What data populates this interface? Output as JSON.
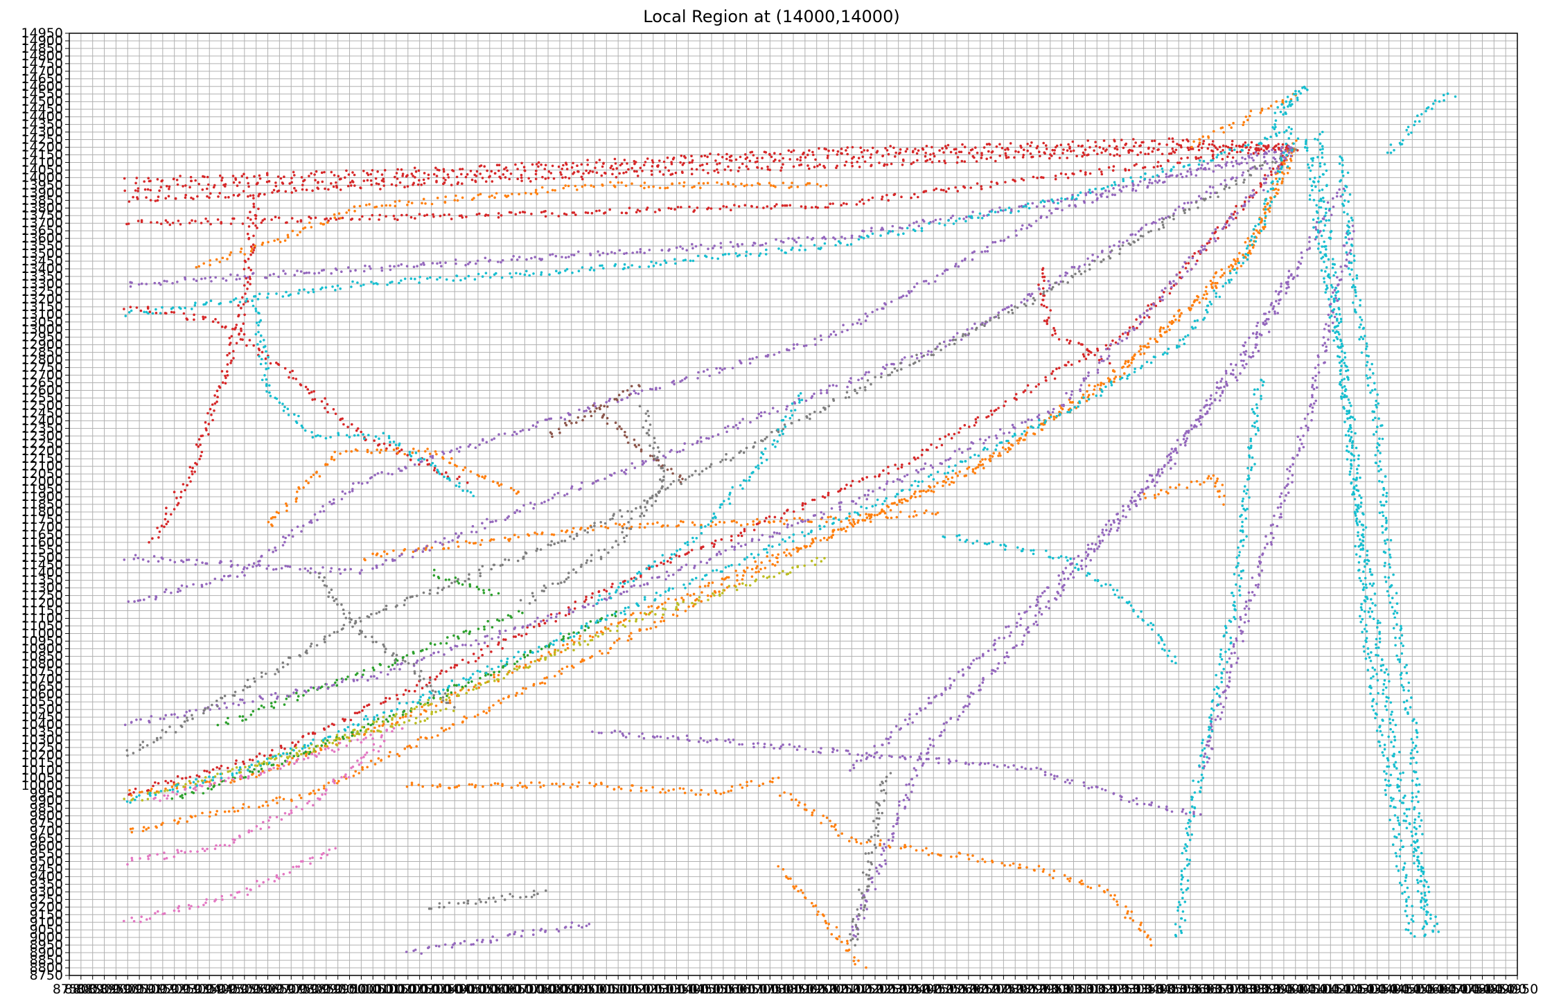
{
  "chart_data": {
    "type": "scatter",
    "title": "Local Region at (14000,14000)",
    "xlabel": "",
    "ylabel": "",
    "xlim": [
      8750,
      14950
    ],
    "ylim": [
      8750,
      14950
    ],
    "x_tick_step": 50,
    "y_tick_step": 50,
    "grid": true,
    "legend": "none",
    "marker": "point",
    "palette": [
      "#1f77b4",
      "#ff7f0e",
      "#2ca02c",
      "#d62728",
      "#9467bd",
      "#8c564b",
      "#e377c2",
      "#7f7f7f",
      "#bcbd22",
      "#17becf"
    ],
    "series": [
      {
        "color": "#d62728",
        "paths": [
          [
            [
              9000,
              13850
            ],
            [
              10500,
              13980
            ],
            [
              12000,
              14080
            ],
            [
              13500,
              14180
            ],
            [
              14000,
              14200
            ]
          ],
          [
            [
              9000,
              13920
            ],
            [
              10500,
              14020
            ],
            [
              12000,
              14140
            ],
            [
              13500,
              14200
            ],
            [
              14000,
              14200
            ]
          ],
          [
            [
              9000,
              13980
            ],
            [
              10500,
              14060
            ],
            [
              12000,
              14180
            ],
            [
              13500,
              14240
            ],
            [
              14000,
              14200
            ]
          ],
          [
            [
              9000,
              13700
            ],
            [
              10500,
              13750
            ],
            [
              12000,
              13820
            ],
            [
              14000,
              14200
            ]
          ],
          [
            [
              9550,
              13900
            ],
            [
              9500,
              13200
            ],
            [
              9400,
              12600
            ],
            [
              9250,
              12000
            ],
            [
              9100,
              11600
            ]
          ],
          [
            [
              9000,
              9950
            ],
            [
              9600,
              10200
            ],
            [
              10300,
              10700
            ],
            [
              11200,
              11400
            ],
            [
              12300,
              12100
            ],
            [
              13300,
              13000
            ],
            [
              14000,
              14200
            ]
          ],
          [
            [
              9000,
              13150
            ],
            [
              9400,
              13050
            ],
            [
              9700,
              12700
            ],
            [
              10000,
              12300
            ],
            [
              10450,
              12000
            ]
          ],
          [
            [
              12900,
              13400
            ],
            [
              12950,
              13000
            ],
            [
              13200,
              12780
            ]
          ]
        ]
      },
      {
        "color": "#ff7f0e",
        "paths": [
          [
            [
              9000,
              9950
            ],
            [
              9500,
              10050
            ],
            [
              10200,
              10450
            ],
            [
              11000,
              11000
            ],
            [
              12000,
              11650
            ],
            [
              12700,
              12150
            ],
            [
              13300,
              12800
            ],
            [
              13800,
              13550
            ],
            [
              14000,
              14200
            ]
          ],
          [
            [
              9000,
              9700
            ],
            [
              9800,
              9950
            ],
            [
              10800,
              10700
            ],
            [
              11800,
              11500
            ],
            [
              12600,
              12050
            ],
            [
              13200,
              12650
            ],
            [
              13800,
              13500
            ],
            [
              14000,
              14250
            ]
          ],
          [
            [
              10200,
              10000
            ],
            [
              11000,
              10000
            ],
            [
              11500,
              9950
            ],
            [
              11800,
              10050
            ]
          ],
          [
            [
              11800,
              9950
            ],
            [
              12100,
              9650
            ],
            [
              12900,
              9450
            ],
            [
              13200,
              9300
            ],
            [
              13400,
              8950
            ]
          ],
          [
            [
              11800,
              9450
            ],
            [
              12000,
              9100
            ],
            [
              12150,
              8800
            ]
          ],
          [
            [
              9600,
              11700
            ],
            [
              9900,
              12200
            ],
            [
              10300,
              12200
            ],
            [
              10700,
              11900
            ]
          ],
          [
            [
              10000,
              11500
            ],
            [
              11000,
              11700
            ],
            [
              12000,
              11750
            ],
            [
              12500,
              11800
            ]
          ],
          [
            [
              13350,
              11900
            ],
            [
              13500,
              11950
            ],
            [
              13650,
              12050
            ],
            [
              13700,
              11850
            ]
          ],
          [
            [
              14000,
              14550
            ],
            [
              13800,
              14400
            ],
            [
              13550,
              14200
            ]
          ],
          [
            [
              9300,
              13400
            ],
            [
              10000,
              13800
            ],
            [
              11000,
              13950
            ],
            [
              12000,
              13950
            ]
          ]
        ]
      },
      {
        "color": "#2ca02c",
        "paths": [
          [
            [
              9200,
              9900
            ],
            [
              9900,
              10300
            ],
            [
              10500,
              10700
            ],
            [
              11100,
              11150
            ]
          ],
          [
            [
              9400,
              10400
            ],
            [
              10100,
              10800
            ],
            [
              10700,
              11150
            ]
          ],
          [
            [
              10300,
              11400
            ],
            [
              10600,
              11250
            ]
          ]
        ]
      },
      {
        "color": "#9467bd",
        "paths": [
          [
            [
              9000,
              13300
            ],
            [
              10000,
              13400
            ],
            [
              11000,
              13500
            ],
            [
              12000,
              13600
            ],
            [
              13000,
              13850
            ],
            [
              14000,
              14200
            ]
          ],
          [
            [
              9000,
              11200
            ],
            [
              9500,
              11400
            ],
            [
              10000,
              12000
            ],
            [
              11000,
              12500
            ],
            [
              12000,
              12950
            ],
            [
              13000,
              13800
            ],
            [
              14000,
              14200
            ]
          ],
          [
            [
              9000,
              11500
            ],
            [
              10000,
              11400
            ],
            [
              11500,
              12300
            ],
            [
              12500,
              12900
            ],
            [
              13500,
              13800
            ],
            [
              14000,
              14200
            ]
          ],
          [
            [
              9000,
              10400
            ],
            [
              10000,
              10700
            ],
            [
              11000,
              11200
            ],
            [
              12000,
              11800
            ],
            [
              13000,
              12500
            ],
            [
              14000,
              14200
            ]
          ],
          [
            [
              11000,
              10350
            ],
            [
              11500,
              10300
            ],
            [
              12200,
              10200
            ],
            [
              12900,
              10100
            ],
            [
              13300,
              9900
            ],
            [
              13600,
              9800
            ]
          ],
          [
            [
              12100,
              10100
            ],
            [
              12700,
              10900
            ],
            [
              13200,
              11700
            ],
            [
              13800,
              12800
            ],
            [
              14200,
              13950
            ]
          ],
          [
            [
              12100,
              9000
            ],
            [
              12400,
              10200
            ],
            [
              12900,
              11100
            ],
            [
              13500,
              12200
            ],
            [
              14000,
              13400
            ]
          ],
          [
            [
              13600,
              10100
            ],
            [
              13800,
              11200
            ],
            [
              14050,
              12400
            ],
            [
              14250,
              13700
            ]
          ],
          [
            [
              10200,
              8900
            ],
            [
              10600,
              9000
            ],
            [
              11000,
              9100
            ]
          ]
        ]
      },
      {
        "color": "#8c564b",
        "paths": [
          [
            [
              10800,
              12300
            ],
            [
              11050,
              12500
            ],
            [
              11200,
              12650
            ]
          ],
          [
            [
              11000,
              12500
            ],
            [
              11200,
              12200
            ],
            [
              11400,
              12000
            ]
          ]
        ]
      },
      {
        "color": "#e377c2",
        "paths": [
          [
            [
              9000,
              9500
            ],
            [
              9400,
              9600
            ],
            [
              9800,
              9900
            ],
            [
              10100,
              10300
            ]
          ],
          [
            [
              9000,
              9100
            ],
            [
              9500,
              9300
            ],
            [
              9900,
              9600
            ]
          ],
          [
            [
              9100,
              9900
            ],
            [
              9600,
              10100
            ],
            [
              10200,
              10400
            ]
          ]
        ]
      },
      {
        "color": "#7f7f7f",
        "paths": [
          [
            [
              9000,
              10200
            ],
            [
              10000,
              11100
            ],
            [
              11000,
              11700
            ],
            [
              12000,
              12500
            ],
            [
              13000,
              13300
            ],
            [
              14000,
              14200
            ]
          ],
          [
            [
              12100,
              8950
            ],
            [
              12150,
              9300
            ],
            [
              12200,
              9700
            ],
            [
              12250,
              10100
            ]
          ],
          [
            [
              9800,
              11400
            ],
            [
              10000,
              11000
            ],
            [
              10200,
              10800
            ],
            [
              10400,
              10500
            ]
          ],
          [
            [
              10300,
              9200
            ],
            [
              10800,
              9300
            ]
          ],
          [
            [
              10700,
              11200
            ],
            [
              11100,
              11600
            ],
            [
              11300,
              12000
            ],
            [
              11200,
              12500
            ]
          ]
        ]
      },
      {
        "color": "#bcbd22",
        "paths": [
          [
            [
              9500,
              10100
            ],
            [
              10400,
              10600
            ],
            [
              11200,
              11100
            ],
            [
              12000,
              11500
            ]
          ],
          [
            [
              9000,
              9900
            ],
            [
              9700,
              10200
            ],
            [
              10400,
              10500
            ]
          ]
        ]
      },
      {
        "color": "#17becf",
        "paths": [
          [
            [
              9000,
              13100
            ],
            [
              10000,
              13300
            ],
            [
              11000,
              13400
            ],
            [
              12000,
              13550
            ],
            [
              13000,
              13850
            ],
            [
              13800,
              14200
            ],
            [
              14000,
              14350
            ]
          ],
          [
            [
              9000,
              9900
            ],
            [
              9500,
              10100
            ],
            [
              10300,
              10600
            ],
            [
              11200,
              11200
            ],
            [
              12200,
              11850
            ],
            [
              13000,
              12450
            ],
            [
              13500,
              12900
            ],
            [
              13800,
              13500
            ],
            [
              14000,
              14300
            ]
          ],
          [
            [
              14050,
              14250
            ],
            [
              14100,
              13600
            ],
            [
              14200,
              12800
            ],
            [
              14250,
              12000
            ],
            [
              14350,
              11000
            ],
            [
              14450,
              10000
            ],
            [
              14600,
              9000
            ]
          ],
          [
            [
              14100,
              14300
            ],
            [
              14150,
              13400
            ],
            [
              14250,
              12200
            ],
            [
              14300,
              11000
            ],
            [
              14400,
              10000
            ],
            [
              14500,
              9000
            ]
          ],
          [
            [
              14200,
              14150
            ],
            [
              14250,
              13300
            ],
            [
              14350,
              12400
            ],
            [
              14400,
              11400
            ],
            [
              14500,
              10400
            ],
            [
              14550,
              9000
            ]
          ],
          [
            [
              14400,
              14150
            ],
            [
              14600,
              14500
            ],
            [
              14700,
              14550
            ]
          ],
          [
            [
              13500,
              9000
            ],
            [
              13550,
              9800
            ],
            [
              13650,
              10500
            ],
            [
              13750,
              11300
            ],
            [
              13800,
              12000
            ],
            [
              13850,
              12700
            ]
          ],
          [
            [
              12500,
              11650
            ],
            [
              13000,
              11500
            ],
            [
              13300,
              11200
            ],
            [
              13500,
              10800
            ]
          ],
          [
            [
              9550,
              13200
            ],
            [
              9600,
              12600
            ],
            [
              9800,
              12300
            ],
            [
              10100,
              12300
            ],
            [
              10500,
              11900
            ]
          ],
          [
            [
              11000,
              11200
            ],
            [
              11400,
              11600
            ],
            [
              11700,
              12100
            ],
            [
              11900,
              12600
            ]
          ],
          [
            [
              13900,
              14300
            ],
            [
              14000,
              14550
            ],
            [
              14050,
              14600
            ],
            [
              13900,
              14400
            ]
          ]
        ]
      }
    ]
  }
}
